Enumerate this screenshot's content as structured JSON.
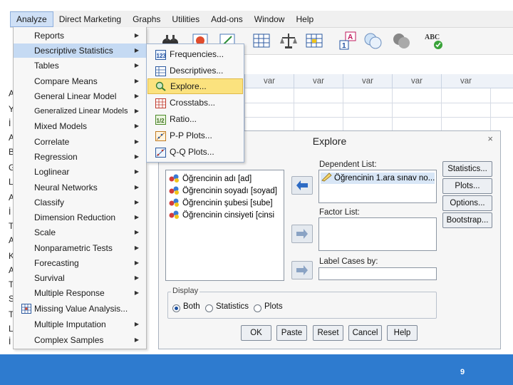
{
  "menubar": {
    "items": [
      "Analyze",
      "Direct Marketing",
      "Graphs",
      "Utilities",
      "Add-ons",
      "Window",
      "Help"
    ]
  },
  "editor": {
    "columns": [
      "var",
      "var",
      "var",
      "var",
      "var"
    ],
    "left_letters": [
      "A",
      "Y",
      "İ",
      "A",
      "B",
      "G",
      "L",
      "A",
      "İ",
      "T",
      "A",
      "K",
      "A",
      "T",
      "S",
      "T",
      "L",
      "İ"
    ]
  },
  "analyze_menu": {
    "items": [
      {
        "label": "Reports",
        "arrow": true
      },
      {
        "label": "Descriptive Statistics",
        "arrow": true,
        "highlighted": true
      },
      {
        "label": "Tables",
        "arrow": true
      },
      {
        "label": "Compare Means",
        "arrow": true
      },
      {
        "label": "General Linear Model",
        "arrow": true
      },
      {
        "label": "Generalized Linear Models",
        "arrow": true
      },
      {
        "label": "Mixed Models",
        "arrow": true
      },
      {
        "label": "Correlate",
        "arrow": true
      },
      {
        "label": "Regression",
        "arrow": true
      },
      {
        "label": "Loglinear",
        "arrow": true
      },
      {
        "label": "Neural Networks",
        "arrow": true
      },
      {
        "label": "Classify",
        "arrow": true
      },
      {
        "label": "Dimension Reduction",
        "arrow": true
      },
      {
        "label": "Scale",
        "arrow": true
      },
      {
        "label": "Nonparametric Tests",
        "arrow": true
      },
      {
        "label": "Forecasting",
        "arrow": true
      },
      {
        "label": "Survival",
        "arrow": true
      },
      {
        "label": "Multiple Response",
        "arrow": true
      },
      {
        "label": "Missing Value Analysis...",
        "arrow": false,
        "icon": "missing-value-icon"
      },
      {
        "label": "Multiple Imputation",
        "arrow": true
      },
      {
        "label": "Complex Samples",
        "arrow": true
      }
    ]
  },
  "submenu": {
    "items": [
      {
        "label": "Frequencies...",
        "icon": "frequencies-icon"
      },
      {
        "label": "Descriptives...",
        "icon": "descriptives-icon"
      },
      {
        "label": "Explore...",
        "icon": "explore-icon",
        "highlighted": true
      },
      {
        "label": "Crosstabs...",
        "icon": "crosstabs-icon"
      },
      {
        "label": "Ratio...",
        "icon": "ratio-icon"
      },
      {
        "label": "P-P Plots...",
        "icon": "pp-plots-icon"
      },
      {
        "label": "Q-Q Plots...",
        "icon": "qq-plots-icon"
      }
    ]
  },
  "dialog": {
    "title": "Explore",
    "close": "×",
    "variables": [
      "Öğrencinin adı [ad]",
      "Öğrencinin soyadı [soyad]",
      "Öğrencinin şubesi [sube]",
      "Öğrencinin cinsiyeti [cinsi"
    ],
    "dependent_label": "Dependent List:",
    "dependent_items": [
      "Öğrencinin 1.ara sınav no..."
    ],
    "factor_label": "Factor List:",
    "label_cases": "Label Cases by:",
    "side_buttons": [
      "Statistics...",
      "Plots...",
      "Options...",
      "Bootstrap..."
    ],
    "display": {
      "legend": "Display",
      "options": [
        "Both",
        "Statistics",
        "Plots"
      ],
      "selected": "Both"
    },
    "bottom_buttons": [
      "OK",
      "Paste",
      "Reset",
      "Cancel",
      "Help"
    ]
  },
  "footer": {
    "page": "9",
    "color": "#2e7bcf"
  }
}
